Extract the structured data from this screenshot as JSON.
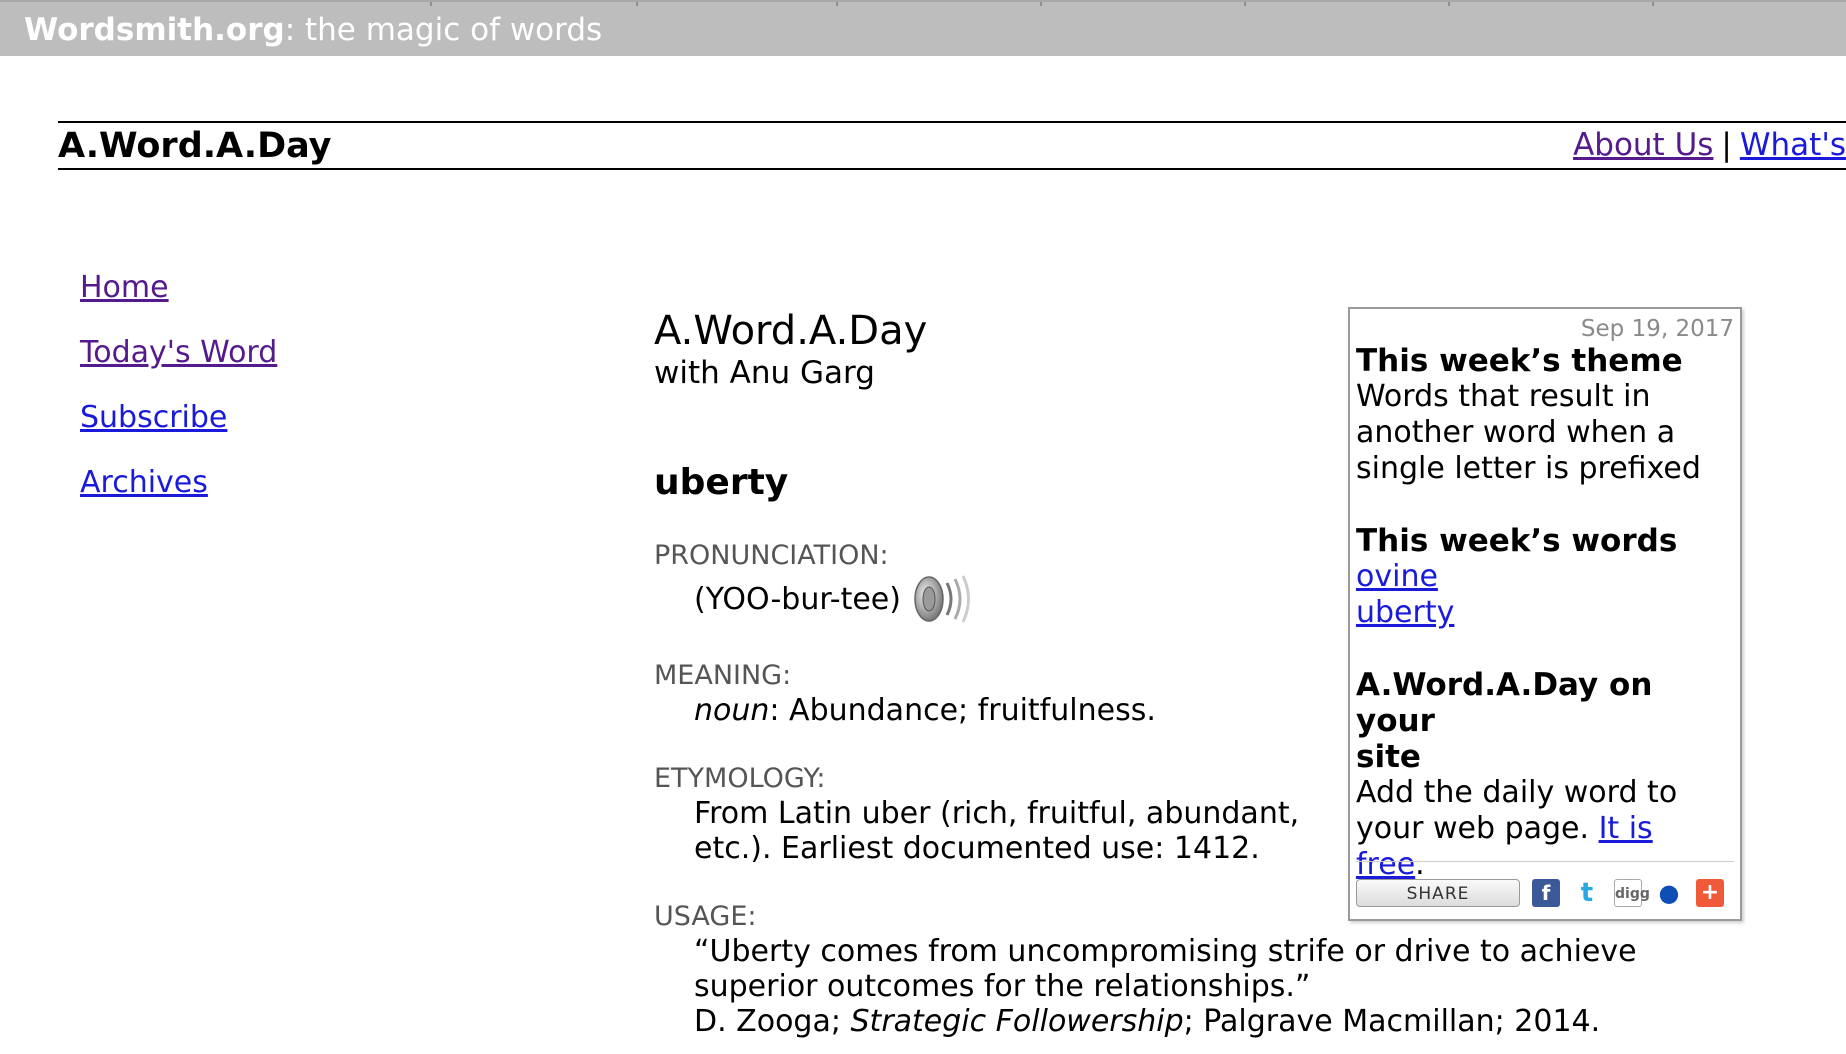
{
  "topbar": {
    "site": "Wordsmith.org",
    "tagline": ": the magic of words"
  },
  "header": {
    "sitename": "A.Word.A.Day",
    "about_link": "About Us",
    "separator": "|",
    "whats_link": "What's"
  },
  "leftnav": {
    "items": [
      {
        "label": "Home",
        "visited": true
      },
      {
        "label": "Today's Word",
        "visited": true
      },
      {
        "label": "Subscribe",
        "visited": false
      },
      {
        "label": "Archives",
        "visited": false
      }
    ]
  },
  "main": {
    "title": "A.Word.A.Day",
    "subtitle": "with Anu Garg",
    "word": "uberty",
    "pronunciation_label": "PRONUNCIATION:",
    "pronunciation": "(YOO-bur-tee)",
    "speaker_icon": "speaker-icon",
    "meaning_label": "MEANING:",
    "meaning_pos": "noun",
    "meaning_text": ": Abundance; fruitfulness.",
    "etymology_label": "ETYMOLOGY:",
    "etymology_line1": "From Latin uber (rich, fruitful, abundant,",
    "etymology_line2": "etc.). Earliest documented use: 1412.",
    "usage_label": "USAGE:",
    "usage_line1": "“Uberty comes from uncompromising strife or drive to achieve",
    "usage_line2": "superior outcomes for the relationships.”",
    "usage_author": "D. Zooga; ",
    "usage_book": "Strategic Followership",
    "usage_pub": "; Palgrave Macmillan; 2014."
  },
  "sidebox": {
    "date": "Sep 19, 2017",
    "theme_heading": "This week’s theme",
    "theme_line1": "Words that result in",
    "theme_line2": "another word when a",
    "theme_line3": "single letter is prefixed",
    "words_heading": "This week’s words",
    "words": [
      "ovine",
      "uberty"
    ],
    "site_heading_line1": "A.Word.A.Day on your",
    "site_heading_line2": "site",
    "site_line1": "Add the daily word to",
    "site_line2_text": "your web page. ",
    "site_link_part1": "It is",
    "site_link_part2": "free",
    "site_period": ".",
    "share_label": "SHARE",
    "share_icons": [
      "facebook-icon",
      "twitter-icon",
      "digg-icon",
      "myspace-icon",
      "more-plus-icon"
    ]
  },
  "colors": {
    "link": "#1a1adb",
    "visited": "#551a8b",
    "topbar": "#bdbdbd"
  }
}
